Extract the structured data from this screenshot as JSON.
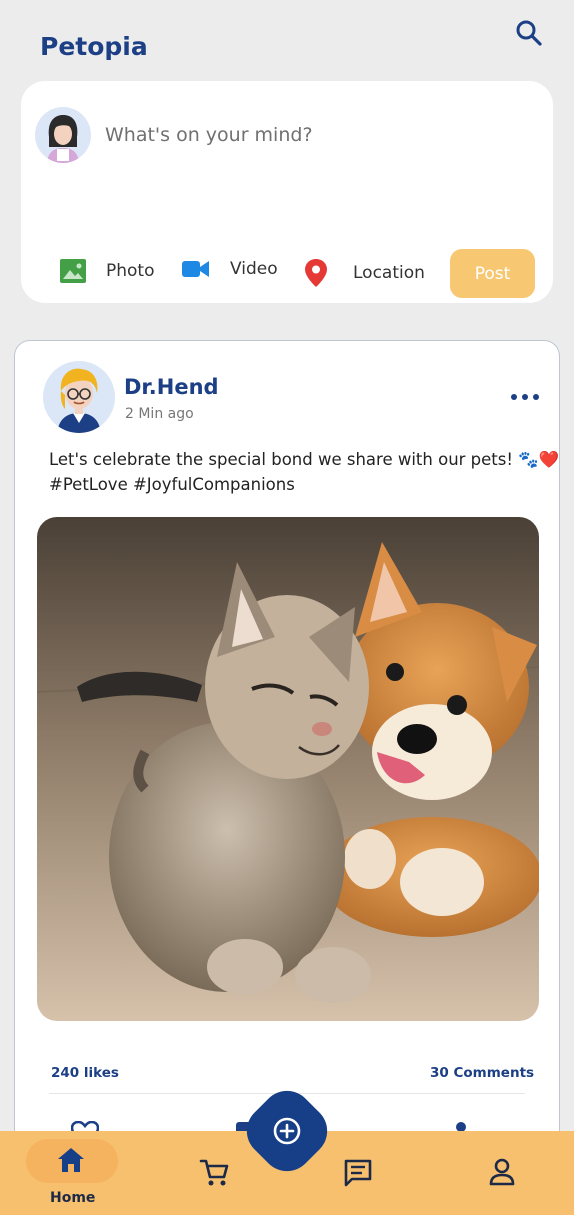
{
  "header": {
    "app_title": "Petopia",
    "search_icon": "search-icon"
  },
  "composer": {
    "placeholder": "What's on your mind?",
    "actions": [
      {
        "label": "Photo",
        "icon": "photo-icon",
        "color": "#43a047"
      },
      {
        "label": "Video",
        "icon": "video-camera-icon",
        "color": "#1e88e5"
      },
      {
        "label": "Location",
        "icon": "location-pin-icon",
        "color": "#e53935"
      }
    ],
    "post_label": "Post"
  },
  "post": {
    "author": "Dr.Hend",
    "time": "2 Min ago",
    "text_line1": "Let's celebrate the special bond we share with our pets! 🐾❤️",
    "text_line2": "#PetLove #JoyfulCompanions",
    "likes": "240 likes",
    "comments": "30 Comments"
  },
  "bottom_nav": {
    "items": [
      {
        "label": "Home",
        "icon": "home-icon",
        "active": true
      },
      {
        "label": "",
        "icon": "cart-icon"
      },
      {
        "label": "",
        "icon": "add-icon"
      },
      {
        "label": "",
        "icon": "chat-icon"
      },
      {
        "label": "",
        "icon": "profile-icon"
      }
    ]
  },
  "colors": {
    "brand": "#1c3f85",
    "accent": "#f7c06e",
    "post_button": "#f7c772"
  }
}
